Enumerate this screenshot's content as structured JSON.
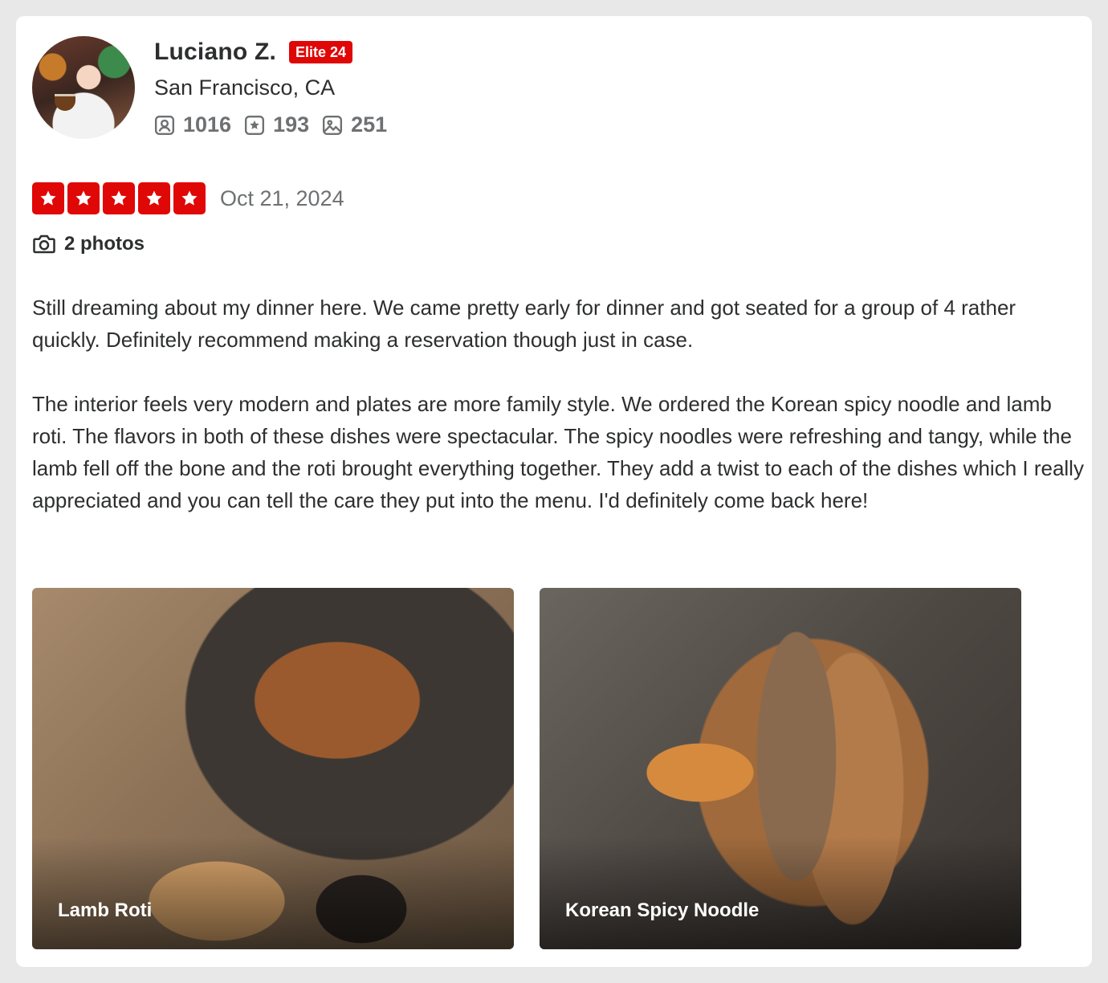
{
  "reviewer": {
    "name": "Luciano Z.",
    "elite_badge": "Elite 24",
    "location": "San Francisco, CA",
    "stats": {
      "friends": "1016",
      "reviews": "193",
      "photos": "251"
    }
  },
  "review": {
    "rating": 5,
    "date": "Oct 21, 2024",
    "photo_count_label": "2 photos",
    "paragraphs": [
      "Still dreaming about my dinner here. We came pretty early for dinner and got seated for a group of 4 rather quickly. Definitely recommend making a reservation though just in case.",
      "The interior feels very modern and plates are more family style. We ordered the Korean spicy noodle and lamb roti. The flavors in both of these dishes were spectacular. The spicy noodles were refreshing and tangy, while the lamb fell off the bone and the roti brought everything together. They add a twist to each of the dishes which I really appreciated and you can tell the care they put into the menu. I'd definitely come back here!"
    ],
    "photos": [
      {
        "caption": "Lamb Roti"
      },
      {
        "caption": "Korean Spicy Noodle"
      }
    ]
  },
  "colors": {
    "accent_red": "#e00707",
    "text_primary": "#2d2e2f",
    "text_secondary": "#6e7072"
  },
  "icons": {
    "friends": "friends-icon",
    "reviews": "review-star-icon",
    "photos": "photo-icon",
    "camera": "camera-icon",
    "star": "star-icon"
  }
}
